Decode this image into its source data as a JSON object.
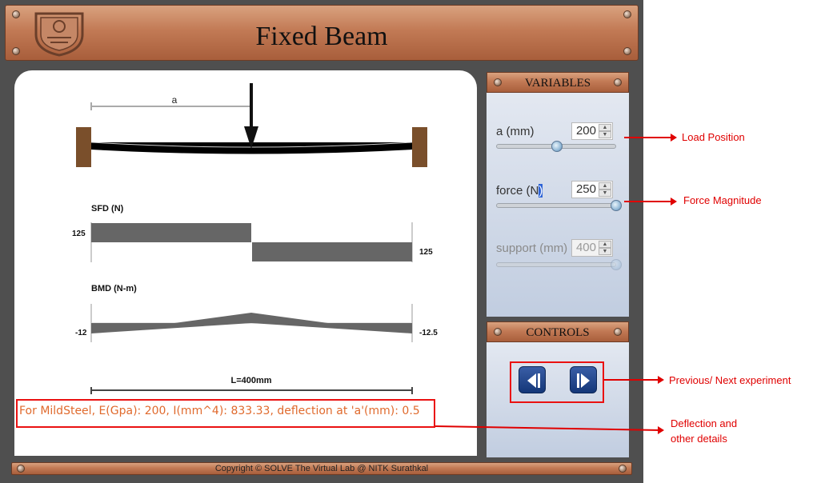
{
  "header": {
    "title": "Fixed Beam"
  },
  "beam": {
    "position_label": "a",
    "length_label": "L=400mm"
  },
  "sfd": {
    "title": "SFD (N)",
    "left_value": "125",
    "right_value": "125"
  },
  "bmd": {
    "title": "BMD (N-m)",
    "left_value": "-12",
    "right_value": "-12.5"
  },
  "info": {
    "text": "For MildSteel, E(Gpa): 200, I(mm^4): 833.33, deflection at 'a'(mm): 0.5"
  },
  "variables": {
    "title": "VARIABLES",
    "a": {
      "label": "a (mm)",
      "value": "200",
      "slider_fraction": 0.5
    },
    "force": {
      "label_prefix": "force (N",
      "label_selected": ")",
      "value": "250",
      "slider_fraction": 1.0
    },
    "support": {
      "label": "support (mm)",
      "value": "400",
      "slider_fraction": 1.0,
      "disabled": true
    }
  },
  "controls": {
    "title": "CONTROLS",
    "prev_icon": "previous-icon",
    "next_icon": "next-icon"
  },
  "footer": {
    "copyright": "Copyright © SOLVE The Virtual Lab @ NITK Surathkal"
  },
  "annotations": {
    "load_position": "Load Position",
    "force_magnitude": "Force Magnitude",
    "prev_next": "Previous/ Next experiment",
    "deflection_line1": "Deflection and",
    "deflection_line2": "other details"
  },
  "colors": {
    "bronze": "#c27a55",
    "annotation": "#e00000",
    "sfd_fill": "#666666",
    "beam": "#000000",
    "support": "#7a4f2b"
  }
}
